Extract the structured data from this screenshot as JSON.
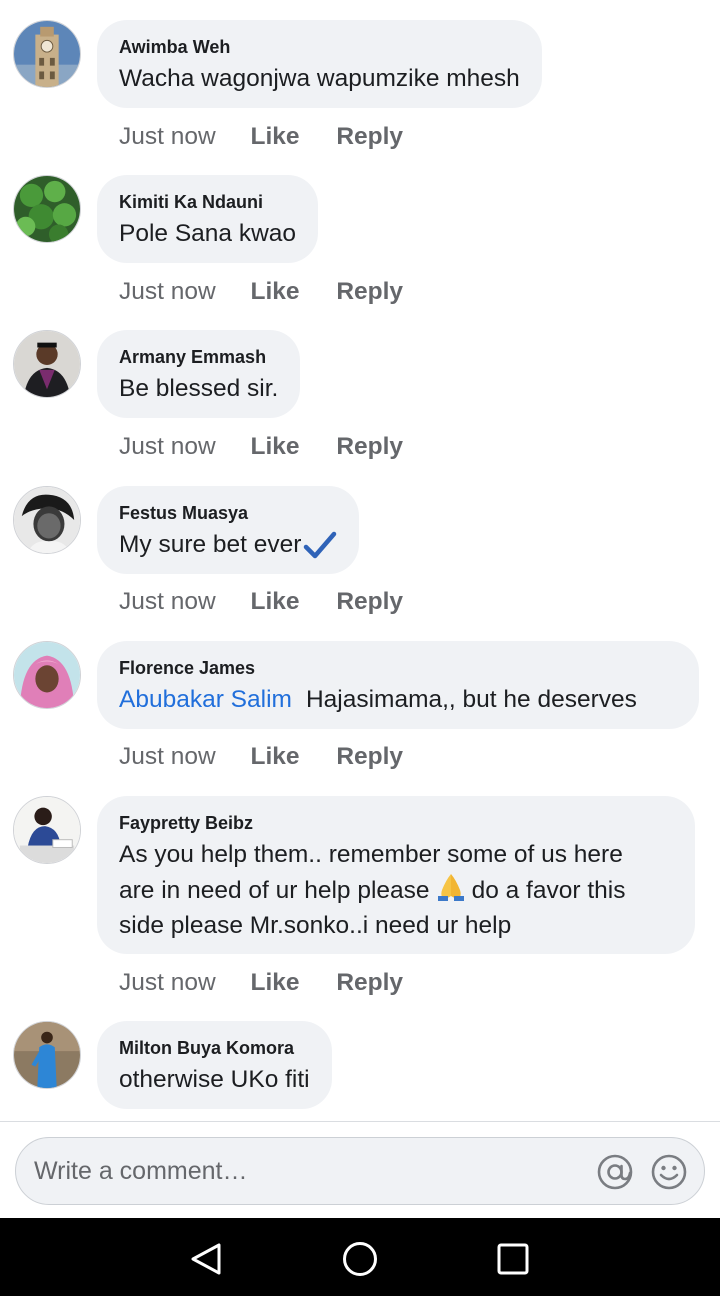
{
  "comments": [
    {
      "author": "Awimba Weh",
      "text": "Wacha wagonjwa wapumzike mhesh",
      "time": "Just now",
      "like": "Like",
      "reply": "Reply",
      "avatar": "clock-tower-avatar"
    },
    {
      "author": "Kimiti Ka Ndauni",
      "text": "Pole Sana kwao",
      "time": "Just now",
      "like": "Like",
      "reply": "Reply",
      "avatar": "green-leaves-avatar"
    },
    {
      "author": "Armany Emmash",
      "text": "Be blessed sir.",
      "time": "Just now",
      "like": "Like",
      "reply": "Reply",
      "avatar": "graduate-avatar"
    },
    {
      "author": "Festus Muasya",
      "text": "My sure bet ever",
      "time": "Just now",
      "like": "Like",
      "reply": "Reply",
      "avatar": "bw-portrait-avatar"
    },
    {
      "author": "Florence James",
      "mention": "Abubakar Salim",
      "text": "Hajasimama,, but he deserves",
      "time": "Just now",
      "like": "Like",
      "reply": "Reply",
      "avatar": "pink-scarf-avatar"
    },
    {
      "author": "Faypretty Beibz",
      "text_line1": "As you help them.. remember some of us here",
      "text_line2a": "are in need of ur help please",
      "text_line2b": "do a favor this",
      "text_line3": "side please Mr.sonko..i need ur help",
      "time": "Just now",
      "like": "Like",
      "reply": "Reply",
      "avatar": "woman-writing-avatar"
    },
    {
      "author": "Milton Buya Komora",
      "text": "otherwise UKo fiti",
      "avatar": "blue-outfit-avatar"
    }
  ],
  "composer": {
    "placeholder": "Write a comment…"
  },
  "icons": {
    "check": "check-mark-icon",
    "pray": "folded-hands-emoji",
    "mention": "at-sign-icon",
    "emoji": "smiley-icon"
  },
  "navbar": {
    "back": "back-triangle-icon",
    "home": "home-circle-icon",
    "recents": "recents-square-icon"
  },
  "colors": {
    "bubble": "#f0f2f5",
    "mention": "#216fdb",
    "meta": "#65676b",
    "navbar": "#000000"
  }
}
